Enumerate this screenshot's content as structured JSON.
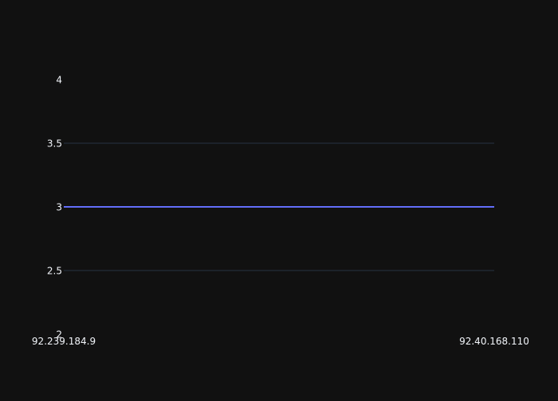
{
  "chart_data": {
    "type": "line",
    "title": "",
    "xlabel": "",
    "ylabel": "",
    "categories": [
      "92.239.184.9",
      "92.40.168.110"
    ],
    "series": [
      {
        "values": [
          3,
          3
        ],
        "color": "#636efa"
      }
    ],
    "ylim": [
      2,
      4
    ],
    "yticks": [
      2,
      2.5,
      3,
      3.5,
      4
    ],
    "ytick_labels": [
      "2",
      "2.5",
      "3",
      "3.5",
      "4"
    ],
    "grid": true,
    "colors": {
      "background": "#111111",
      "plot_background": "#111111",
      "grid": "#283442",
      "text": "#f2f5fa"
    }
  }
}
